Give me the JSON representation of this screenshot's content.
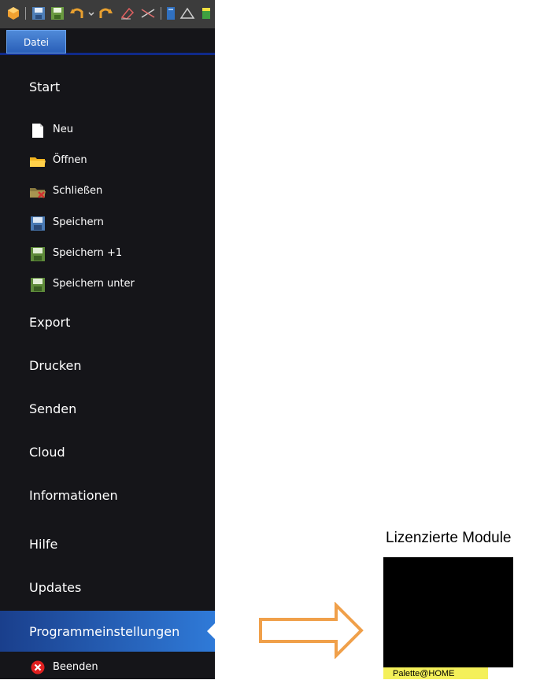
{
  "tab": {
    "label": "Datei"
  },
  "menu": {
    "start": "Start",
    "neu": "Neu",
    "oeffnen": "Öffnen",
    "schliessen": "Schließen",
    "speichern": "Speichern",
    "speichern_plus": "Speichern +1",
    "speichern_unter": "Speichern unter",
    "export": "Export",
    "drucken": "Drucken",
    "senden": "Senden",
    "cloud": "Cloud",
    "informationen": "Informationen",
    "hilfe": "Hilfe",
    "updates": "Updates",
    "programmeinstellungen": "Programmeinstellungen",
    "beenden": "Beenden"
  },
  "license": {
    "title": "Lizenzierte Module",
    "badge": "Palette@HOME"
  },
  "colors": {
    "panel_bg": "#151519",
    "selected": "#2f7ad8",
    "arrow": "#f0a04a",
    "badge": "#f4f05a"
  }
}
